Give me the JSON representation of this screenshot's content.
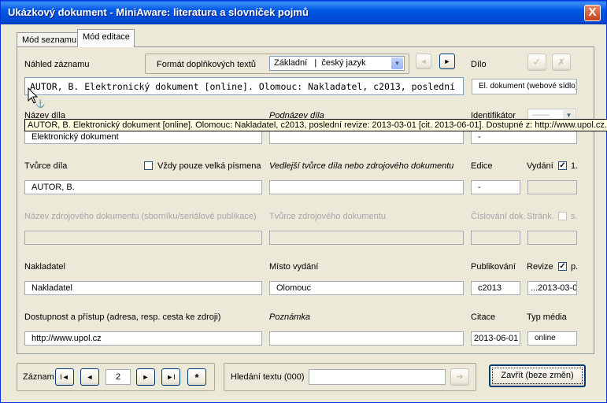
{
  "window": {
    "title": "Ukázkový dokument - MiniAware: literatura a slovníček pojmů",
    "close_label": "X"
  },
  "tabs": [
    "Mód seznamu",
    "Mód editace"
  ],
  "preview": {
    "label": "Náhled záznamu",
    "format_label": "Formát doplňkových textů",
    "format_value": "Základní   |  český jazyk",
    "text": "AUTOR, B. Elektronický dokument [online]. Olomouc: Nakladatel, c2013, poslední",
    "tooltip": "AUTOR, B. Elektronický dokument [online]. Olomouc: Nakladatel, c2013, poslední revize: 2013-03-01 [cit. 2013-06-01]. Dostupné z: http://www.upol.cz."
  },
  "nav_buttons": {
    "prev": "◄",
    "next": "►"
  },
  "dilo": {
    "label": "Dílo",
    "value": "El. dokument (webové sídlo)",
    "ok": "✓",
    "cancel": "✗"
  },
  "fields": {
    "nazev": {
      "label": "Název díla",
      "value": "Elektronický dokument"
    },
    "podnazev": {
      "label": "Podnázev díla",
      "value": ""
    },
    "identifikator": {
      "label": "Identifikátor",
      "value": "-",
      "select": "——"
    },
    "tvurce": {
      "label": "Tvůrce díla",
      "value": "AUTOR, B."
    },
    "velka_pismena": {
      "label": "Vždy pouze velká písmena",
      "checked": false
    },
    "vedlejsi": {
      "label": "Vedlejší tvůrce díla nebo zdrojového dokumentu",
      "value": ""
    },
    "edice": {
      "label": "Edice",
      "value": "-"
    },
    "vydani": {
      "label": "Vydání",
      "check_label": "1.",
      "checked": true,
      "value": ""
    },
    "zdroj_nazev": {
      "label": "Název zdrojového dokumentu (sborníku/seriálové publikace)",
      "value": ""
    },
    "zdroj_tvurce": {
      "label": "Tvůrce zdrojového dokumentu",
      "value": ""
    },
    "cislovani": {
      "label": "Číslování dok.",
      "value": ""
    },
    "stranky": {
      "label": "Stránk.",
      "check_label": "s.",
      "checked": false,
      "value": ""
    },
    "nakladatel": {
      "label": "Nakladatel",
      "value": "Nakladatel"
    },
    "misto": {
      "label": "Místo vydání",
      "value": "Olomouc"
    },
    "publikovani": {
      "label": "Publikování",
      "value": "c2013"
    },
    "revize": {
      "label": "Revize",
      "check_label": "p.",
      "checked": true,
      "value": "...2013-03-0"
    },
    "dostupnost": {
      "label": "Dostupnost a přístup (adresa, resp. cesta ke zdroji)",
      "value": "http://www.upol.cz"
    },
    "poznamka": {
      "label": "Poznámka",
      "value": ""
    },
    "citace": {
      "label": "Citace",
      "value": "2013-06-01"
    },
    "typ_media": {
      "label": "Typ média",
      "value": "online"
    }
  },
  "record": {
    "label": "Záznam",
    "first": "I◄",
    "prev": "◄",
    "value": "2",
    "next": "►",
    "last": "►I",
    "new": "*"
  },
  "search": {
    "label": "Hledání textu (000)",
    "value": "",
    "go": "➔"
  },
  "close_button": "Zavřít (beze změn)"
}
